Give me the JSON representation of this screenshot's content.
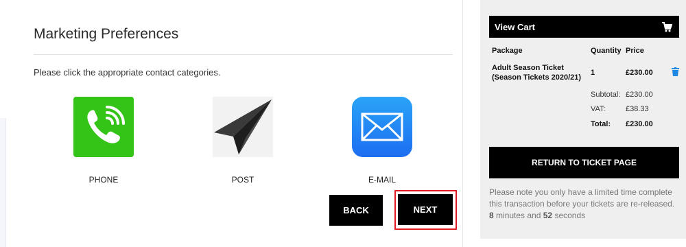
{
  "marketing": {
    "title": "Marketing Preferences",
    "instructions": "Please click the appropriate contact categories.",
    "options": [
      {
        "label": "PHONE",
        "icon": "phone-icon"
      },
      {
        "label": "POST",
        "icon": "paper-plane-icon"
      },
      {
        "label": "E-MAIL",
        "icon": "envelope-icon"
      }
    ],
    "back_label": "BACK",
    "next_label": "NEXT"
  },
  "cart": {
    "header": "View Cart",
    "columns": {
      "package": "Package",
      "quantity": "Quantity",
      "price": "Price"
    },
    "item": {
      "name": "Adult Season Ticket (Season Tickets 2020/21)",
      "quantity": "1",
      "price": "£230.00"
    },
    "subtotal_label": "Subtotal:",
    "subtotal": "£230.00",
    "vat_label": "VAT:",
    "vat": "£38.33",
    "total_label": "Total:",
    "total": "£230.00",
    "return_label": "RETURN TO TICKET PAGE",
    "note": {
      "text": "Please note you only have a limited time complete this transaction before your tickets are re-released.",
      "minutes": "8",
      "minutes_label": "minutes and",
      "seconds": "52",
      "seconds_label": "seconds"
    }
  },
  "colors": {
    "accent_black": "#000000",
    "highlight_red": "#e11b22",
    "phone_green": "#34c418",
    "trash_blue": "#1e88e5"
  }
}
